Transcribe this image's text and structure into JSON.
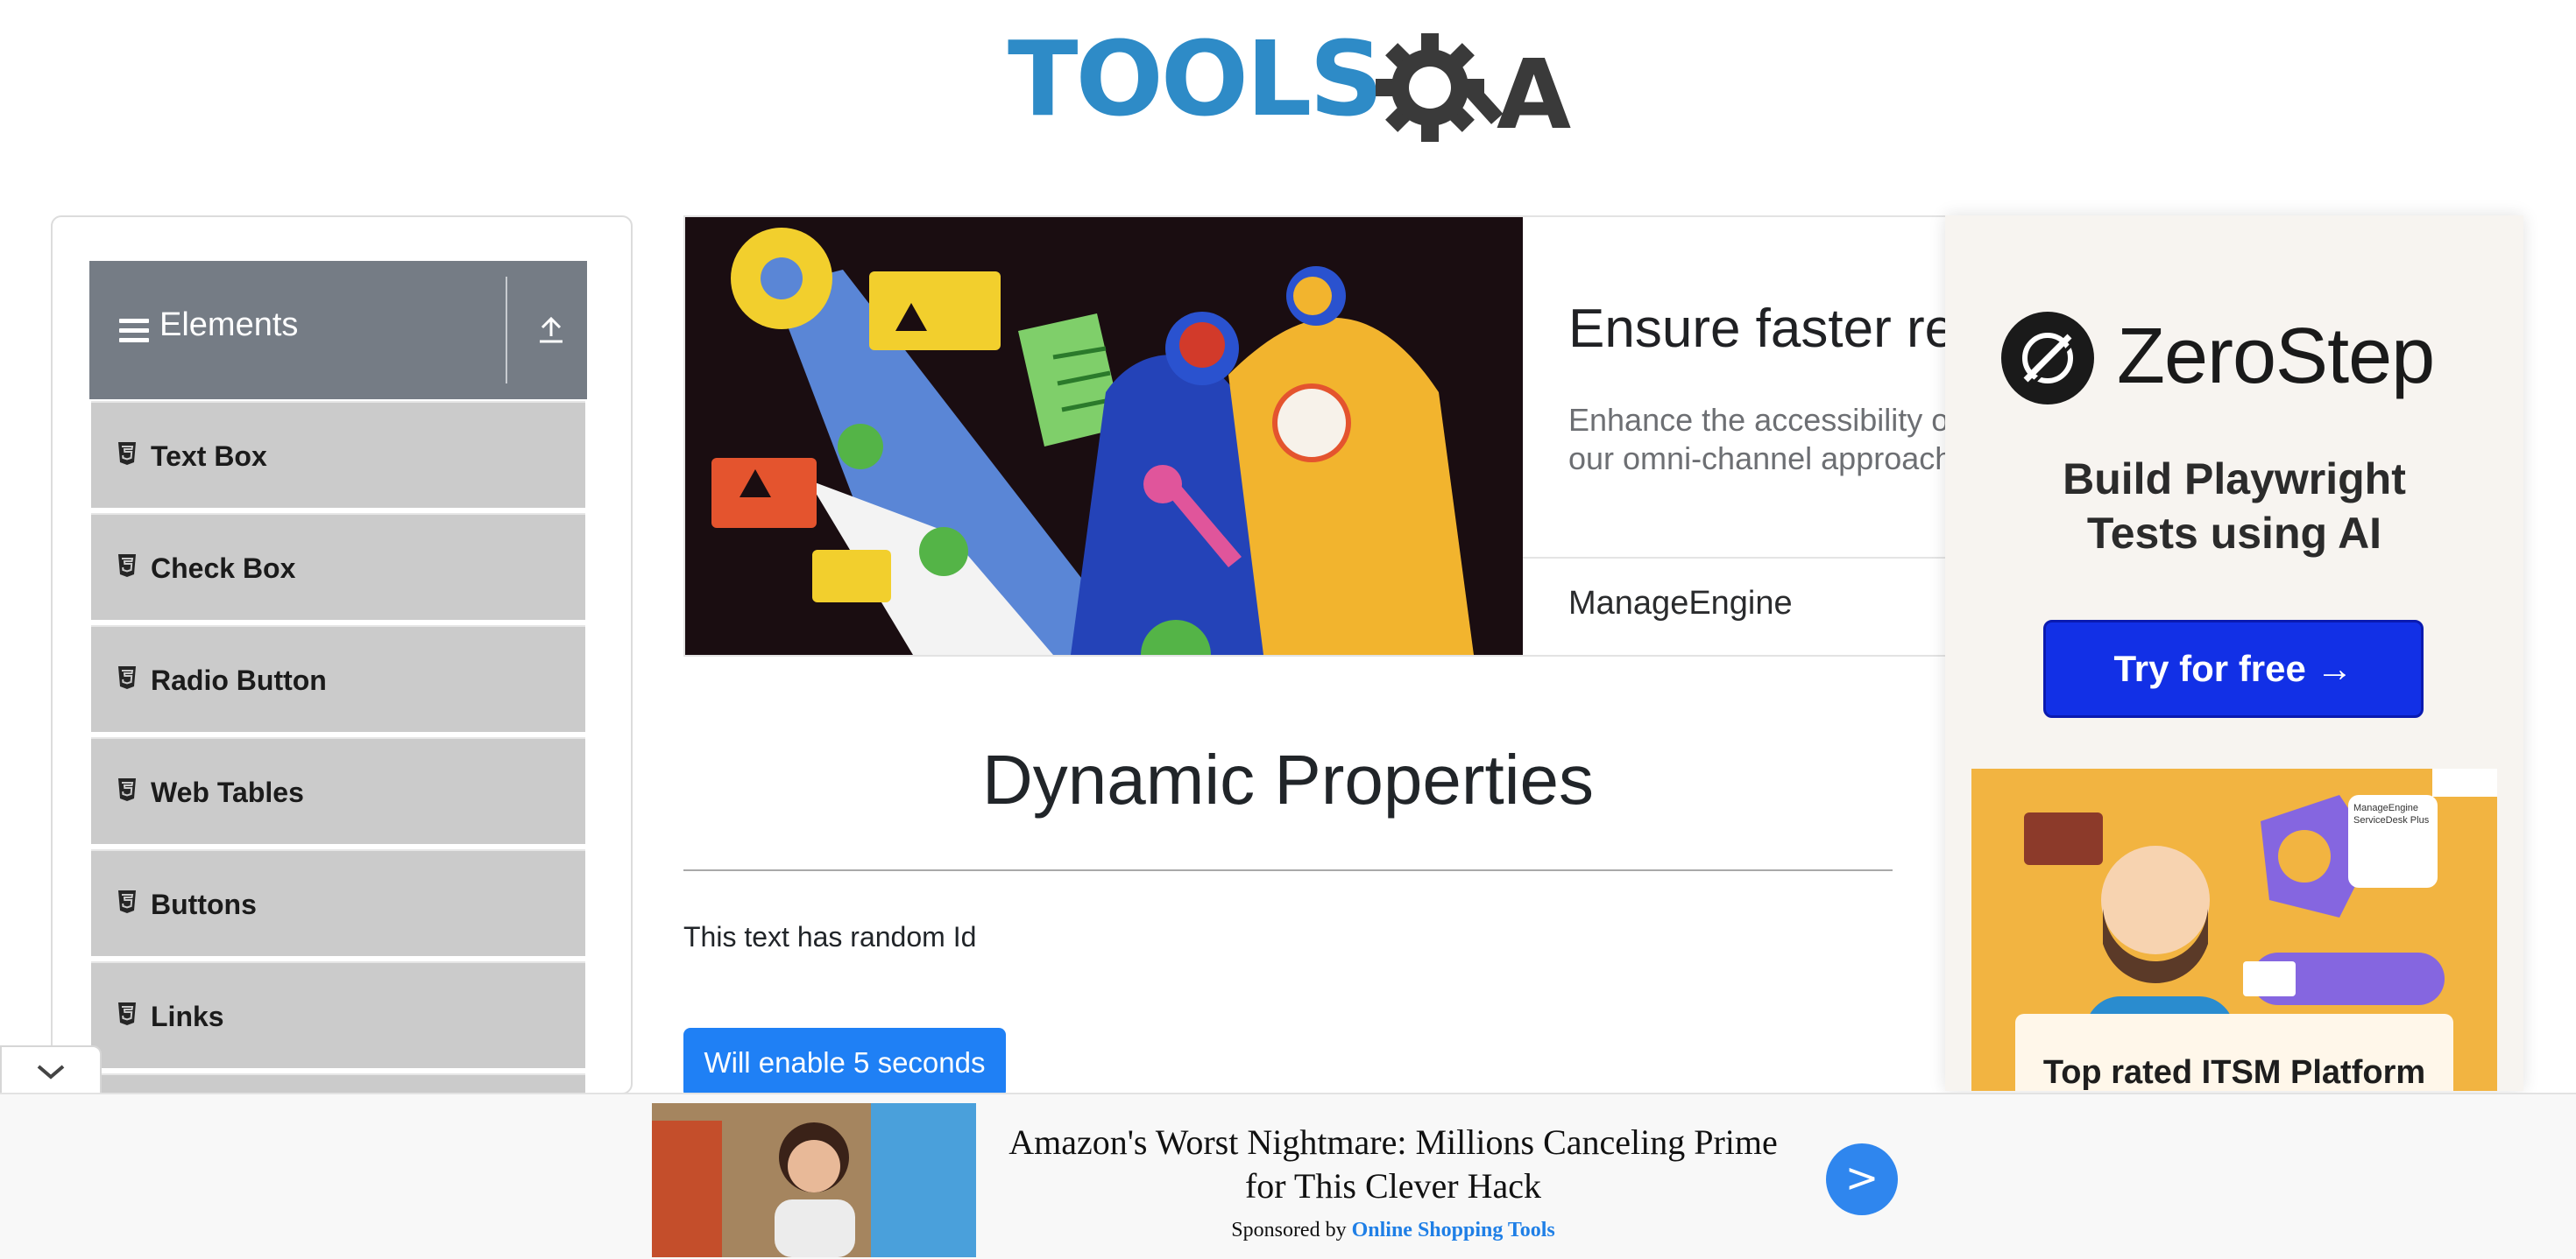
{
  "header": {
    "logo_text": "TOOLS",
    "logo_suffix": "A"
  },
  "sidebar": {
    "group_title": "Elements",
    "items": [
      {
        "label": "Text Box"
      },
      {
        "label": "Check Box"
      },
      {
        "label": "Radio Button"
      },
      {
        "label": "Web Tables"
      },
      {
        "label": "Buttons"
      },
      {
        "label": "Links"
      }
    ]
  },
  "banner_ad": {
    "headline": "Ensure faster res",
    "body_line1": "Enhance the accessibility o",
    "body_line2": "our omni-channel approach",
    "brand": "ManageEngine"
  },
  "main": {
    "title": "Dynamic Properties",
    "random_text": "This text has random Id",
    "enable_button": "Will enable 5 seconds"
  },
  "side_ad": {
    "brand": "ZeroStep",
    "tagline_line1": "Build Playwright",
    "tagline_line2": "Tests using AI",
    "cta": "Try for free →",
    "secondary_brand": "ManageEngine ServiceDesk Plus",
    "secondary_cta": "Top rated ITSM Platform"
  },
  "bottom_ad": {
    "headline": "Amazon's Worst Nightmare: Millions Canceling Prime for This Clever Hack",
    "sponsored_by": "Sponsored by",
    "sponsor": "Online Shopping Tools",
    "go_symbol": ">"
  },
  "colors": {
    "brand_blue": "#2e8bc7",
    "button_blue": "#1f80f5",
    "sidebar_header": "#757c85",
    "sidebar_item": "#cbcbcb",
    "zerostep_cta": "#1230e6"
  }
}
